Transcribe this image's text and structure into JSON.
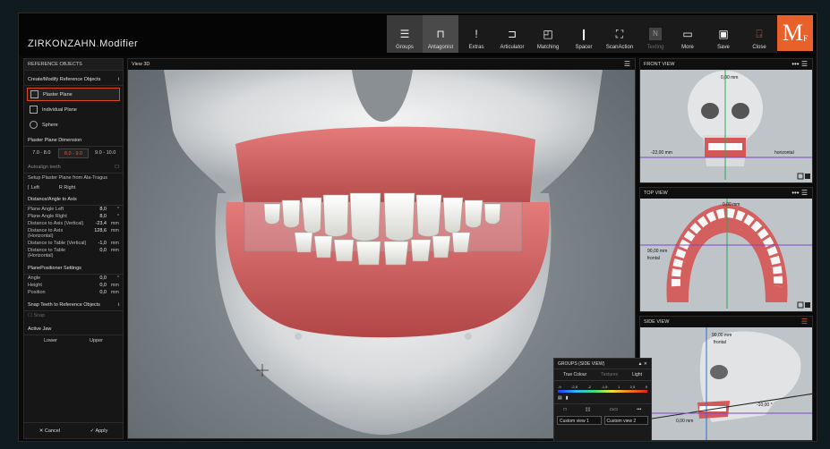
{
  "app": {
    "brand_main": "ZIRKONZAHN",
    "brand_sep": ".",
    "brand_sub": "Modifier",
    "logo_letter": "M",
    "logo_sub": "F"
  },
  "toolbar": {
    "groups": "Groups",
    "antagonist": "Antagonist",
    "extras": "Extras",
    "articulator": "Articulator",
    "matching": "Matching",
    "spacer": "Spacer",
    "scanaction": "ScanAction",
    "texting": "Texting",
    "more": "More",
    "save": "Save",
    "close": "Close"
  },
  "left_panel": {
    "header": "REFERENCE OBJECTS",
    "create_section": "Create/Modify Reference Objects",
    "items": [
      "Plaster Plane",
      "Individual Plane",
      "Sphere"
    ],
    "plaster_dim_label": "Plaster Plane Dimension",
    "dimensions": [
      "7.0 - 8.0",
      "8.0 - 9.0",
      "9.0 - 10.0"
    ],
    "autoalign": "Autoalign teeth",
    "setup_label": "Setup Plaster Plane from Ala-Tragus",
    "left": "Left",
    "right": "Right",
    "distance_section": "Distance/Angle to Axis",
    "measures": [
      {
        "k": "Plane Angle Left",
        "v": "8,0",
        "u": "°"
      },
      {
        "k": "Plane Angle Right",
        "v": "8,0",
        "u": "°"
      },
      {
        "k": "Distance to Axis (Vertical)",
        "v": "-23,4",
        "u": "mm"
      },
      {
        "k": "Distance to Axis (Horizontal)",
        "v": "128,6",
        "u": "mm"
      },
      {
        "k": "Distance to Table (Vertical)",
        "v": "-1,0",
        "u": "mm"
      },
      {
        "k": "Distance to Table (Horizontal)",
        "v": "0,0",
        "u": "mm"
      }
    ],
    "positioner_section": "PlanePositioner Settings",
    "positioner": [
      {
        "k": "Angle",
        "v": "0,0",
        "u": "°"
      },
      {
        "k": "Height",
        "v": "0,0",
        "u": "mm"
      },
      {
        "k": "Position",
        "v": "0,0",
        "u": "mm"
      }
    ],
    "snap_section": "Snap Teeth to Reference Objects",
    "snap_btn": "Snap",
    "active_jaw": "Active Jaw",
    "lower": "Lower",
    "upper": "Upper",
    "cancel": "Cancel",
    "apply": "Apply"
  },
  "view3d": {
    "title": "View 3D"
  },
  "front_view": {
    "title": "FRONT VIEW",
    "m1": "0,00 mm",
    "m2": "-22,00 mm",
    "m3": "horizontal"
  },
  "top_view": {
    "title": "TOP VIEW",
    "m1": "0,00 mm",
    "m2": "90,00 mm",
    "m3": "frontal"
  },
  "side_view": {
    "title": "SIDE VIEW",
    "m1": "90,00 mm",
    "m2": "frontal",
    "m3": "-10,00 °",
    "m4": "0,00 mm"
  },
  "groups_panel": {
    "title": "GROUPS (SIDE VIEW)",
    "tabs": [
      "True Colour",
      "Textures",
      "Light"
    ],
    "scale": [
      "-9",
      "-2,5",
      "-2",
      "-1,5",
      "1",
      "2,5",
      "9"
    ],
    "custom1": "Custom view 1",
    "custom2": "Custom view 2"
  }
}
